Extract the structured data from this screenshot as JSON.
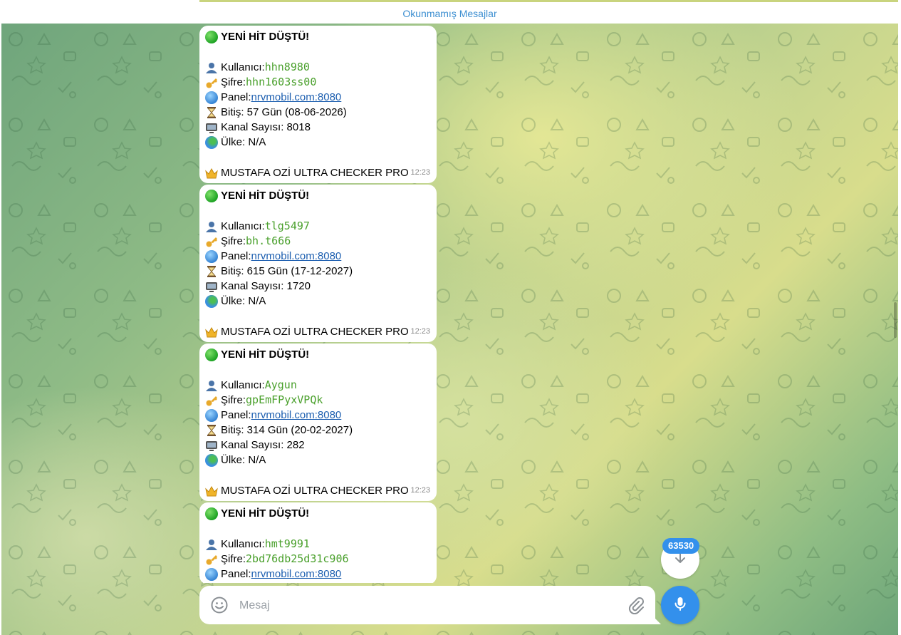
{
  "unread_bar": {
    "label": "Okunmamış Mesajlar"
  },
  "messages": [
    {
      "title": "YENİ HİT DÜŞTÜ!",
      "user_label": "Kullanıcı: ",
      "user": "hhn8980",
      "pass_label": "Şifre: ",
      "pass": "hhn1603ss00",
      "panel_label": "Panel: ",
      "panel": "nrvmobil.com:8080",
      "expiry": "Bitiş: 57 Gün (08-06-2026)",
      "channels": "Kanal Sayısı: 8018",
      "country": "Ülke: N/A",
      "signature": "MUSTAFA OZİ ULTRA CHECKER PRO",
      "time": "12:23"
    },
    {
      "title": "YENİ HİT DÜŞTÜ!",
      "user_label": "Kullanıcı: ",
      "user": "tlg5497",
      "pass_label": "Şifre: ",
      "pass": "bh.t666",
      "panel_label": "Panel: ",
      "panel": "nrvmobil.com:8080",
      "expiry": "Bitiş: 615 Gün (17-12-2027)",
      "channels": "Kanal Sayısı: 1720",
      "country": "Ülke: N/A",
      "signature": "MUSTAFA OZİ ULTRA CHECKER PRO",
      "time": "12:23"
    },
    {
      "title": "YENİ HİT DÜŞTÜ!",
      "user_label": "Kullanıcı: ",
      "user": "Aygun",
      "pass_label": "Şifre: ",
      "pass": "gpEmFPyxVPQk",
      "panel_label": "Panel: ",
      "panel": "nrvmobil.com:8080",
      "expiry": "Bitiş: 314 Gün (20-02-2027)",
      "channels": "Kanal Sayısı: 282",
      "country": "Ülke: N/A",
      "signature": "MUSTAFA OZİ ULTRA CHECKER PRO",
      "time": "12:23"
    },
    {
      "title": "YENİ HİT DÜŞTÜ!",
      "user_label": "Kullanıcı: ",
      "user": "hmt9991",
      "pass_label": "Şifre: ",
      "pass": "2bd76db25d31c906",
      "panel_label": "Panel: ",
      "panel": "nrvmobil.com:8080"
    }
  ],
  "scroll_down": {
    "unread_count": "63530"
  },
  "composer": {
    "placeholder": "Mesaj"
  },
  "icons": {
    "emoji": "smiley-icon",
    "attach": "paperclip-icon",
    "mic": "microphone-icon",
    "scroll": "arrow-down-icon"
  },
  "colors": {
    "accent": "#3390ec",
    "code_text": "#4aa02c",
    "link": "#1d5fb0"
  }
}
